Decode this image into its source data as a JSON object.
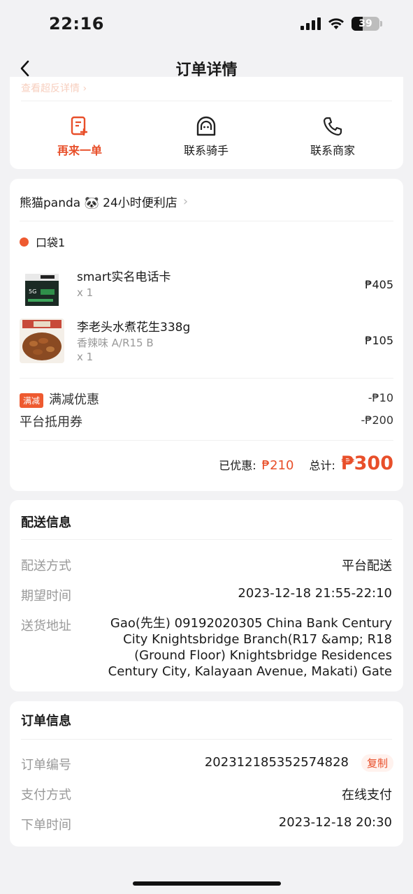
{
  "status_bar": {
    "time": "22:16",
    "battery": "39"
  },
  "nav": {
    "title": "订单详情"
  },
  "actions": {
    "peek_text": "查看超反详情 ›",
    "reorder": "再来一单",
    "contact_rider": "联系骑手",
    "contact_merchant": "联系商家"
  },
  "order": {
    "store_name": "熊猫panda 🐼 24小时便利店",
    "bag_label": "口袋1",
    "items": [
      {
        "name": "smart实名电话卡",
        "spec": "",
        "qty": "x 1",
        "price": "₱405"
      },
      {
        "name": "李老头水煮花生338g",
        "spec": "香辣味 A/R15 B",
        "qty": "x 1",
        "price": "₱105"
      }
    ],
    "promo_badge": "满减",
    "promo_label": "满减优惠",
    "promo_amount": "-₱10",
    "coupon_label": "平台抵用券",
    "coupon_amount": "-₱200",
    "saved_label": "已优惠:",
    "saved_amount": "₱210",
    "total_label": "总计:",
    "total_amount": "₱300"
  },
  "delivery": {
    "title": "配送信息",
    "method_label": "配送方式",
    "method_value": "平台配送",
    "time_label": "期望时间",
    "time_value": "2023-12-18 21:55-22:10",
    "address_label": "送货地址",
    "address_value": "Gao(先生) 09192020305 China Bank Century City Knightsbridge Branch(R17 &amp; R18 (Ground Floor) Knightsbridge Residences Century City, Kalayaan Avenue, Makati) Gate"
  },
  "order_info": {
    "title": "订单信息",
    "number_label": "订单编号",
    "number_value": "202312185352574828",
    "copy_label": "复制",
    "payment_label": "支付方式",
    "payment_value": "在线支付",
    "placed_label": "下单时间",
    "placed_value": "2023-12-18 20:30"
  },
  "colors": {
    "accent": "#e84f2a",
    "background": "#f2f2f4"
  }
}
